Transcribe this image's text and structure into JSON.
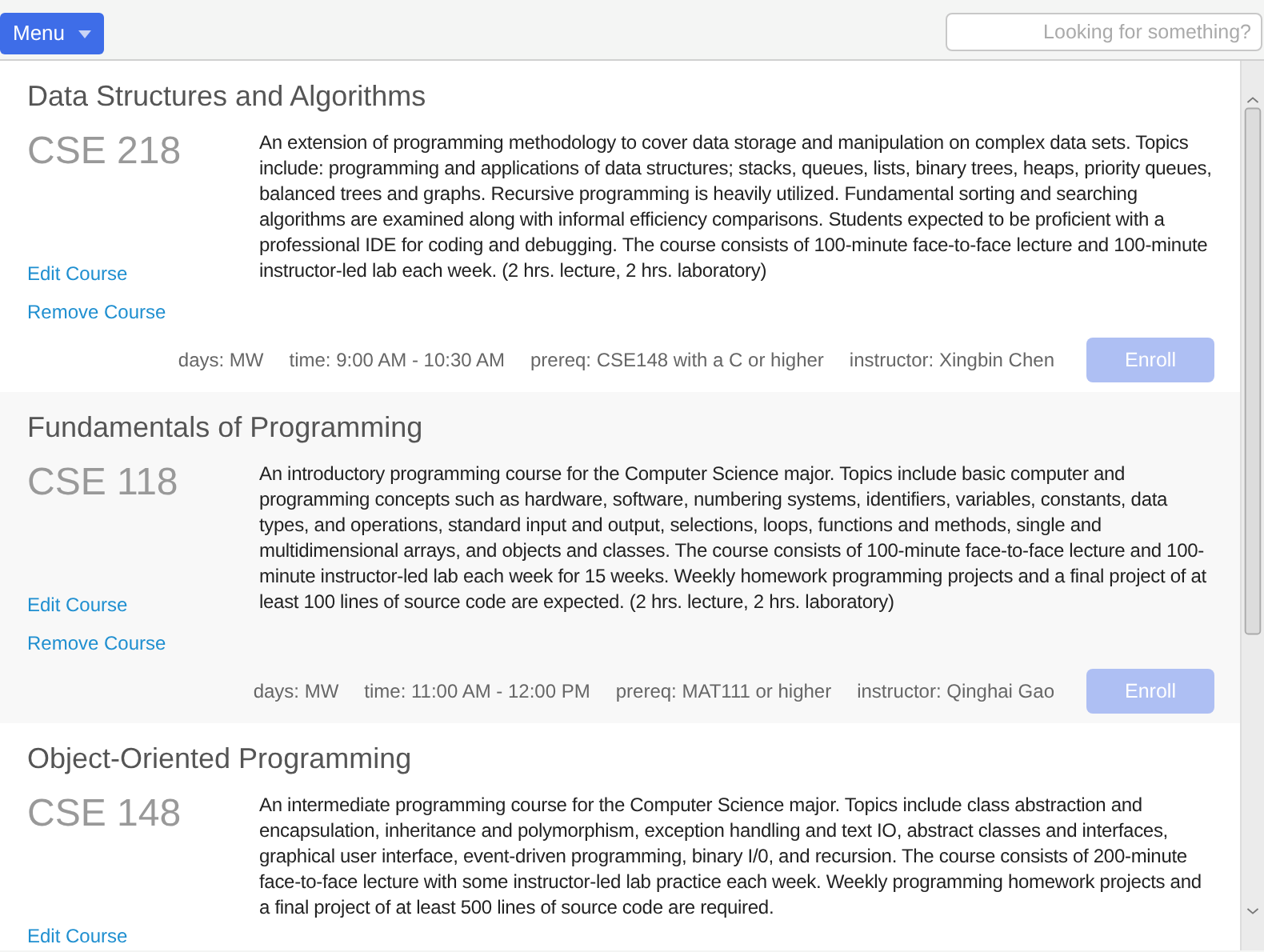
{
  "toolbar": {
    "menu_button": "Menu",
    "search": {
      "placeholder": "Looking for something?"
    }
  },
  "courses": [
    {
      "title": "Data Structures and Algorithms",
      "code": "CSE 218",
      "description": "An extension of programming methodology to cover data storage and manipulation on complex data sets. Topics include: programming and applications of data structures; stacks, queues, lists, binary trees, heaps, priority queues, balanced trees and graphs. Recursive programming is heavily utilized. Fundamental sorting and searching algorithms are examined along with informal efficiency comparisons. Students expected to be proficient with a professional IDE for coding and debugging. The course consists of 100-minute face-to-face lecture and 100-minute instructor-led lab each week. (2 hrs. lecture, 2 hrs. laboratory)",
      "actions": [
        "Edit Course",
        "Remove Course"
      ],
      "meta": [
        "days: MW",
        "time: 9:00 AM - 10:30 AM",
        "prereq: CSE148 with a C or higher",
        "instructor: Xingbin Chen"
      ],
      "enroll": {
        "label": "Enroll",
        "disabled": true
      }
    },
    {
      "title": "Fundamentals of Programming",
      "code": "CSE 118",
      "description": "An introductory programming course for the Computer Science major. Topics include basic computer and programming concepts such as hardware, software, numbering systems, identifiers, variables, constants, data types, and operations, standard input and output, selections, loops, functions and methods, single and multidimensional arrays, and objects and classes. The course consists of 100-minute face-to-face lecture and 100-minute instructor-led lab each week for 15 weeks. Weekly homework programming projects and a final project of at least 100 lines of source code are expected. (2 hrs. lecture, 2 hrs. laboratory)",
      "actions": [
        "Edit Course",
        "Remove Course"
      ],
      "meta": [
        "days: MW",
        "time: 11:00 AM - 12:00 PM",
        "prereq: MAT111 or higher",
        "instructor: Qinghai Gao"
      ],
      "enroll": {
        "label": "Enroll",
        "disabled": true
      }
    },
    {
      "title": "Object-Oriented Programming",
      "code": "CSE 148",
      "description": "An intermediate programming course for the Computer Science major. Topics include class abstraction and encapsulation, inheritance and polymorphism, exception handling and text IO, abstract classes and interfaces, graphical user interface, event-driven programming, binary I/0, and recursion. The course consists of 200-minute face-to-face lecture with some instructor-led lab practice each week. Weekly programming homework projects and a final project of at least 500 lines of source code are required.",
      "actions": [
        "Edit Course"
      ]
    }
  ]
}
